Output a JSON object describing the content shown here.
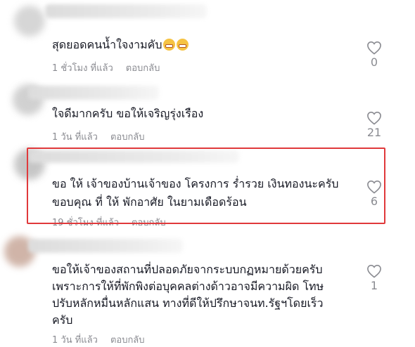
{
  "comments": [
    {
      "text_lines": [
        "สุดยอดคนน้ำใจงามคับ"
      ],
      "emoji": [
        "grinning-face-emoji",
        "grinning-face-emoji"
      ],
      "time": "1 ชั่วโมง ที่แล้ว",
      "reply": "ตอบกลับ",
      "likes": "0"
    },
    {
      "text_lines": [
        "ใจดีมากครับ ขอให้เจริญรุ่งเรือง"
      ],
      "time": "1 วัน ที่แล้ว",
      "reply": "ตอบกลับ",
      "likes": "21"
    },
    {
      "text_lines": [
        "ขอ ให้ เจ้าของบ้านเจ้าของ โครงการ ร่ำรวย เงินทองนะครับ",
        "ขอบคุณ ที่ ให้ พักอาศัย ในยามเดือดร้อน"
      ],
      "time": "19 ชั่วโมง ที่แล้ว",
      "reply": "ตอบกลับ",
      "likes": "6"
    },
    {
      "text_lines": [
        "ขอให้เจ้าของสถานที่ปลอดภัยจากระบบกฏหมายด้วยครับ",
        "เพราะการให้ที่พักพิงต่อบุคคลต่างด้าวอาจมีความผิด โทษ",
        "ปรับหลักหมื่นหลักแสน ทางที่ดีให้ปรึกษาจนท.รัฐฯโดยเร็ว",
        "ครับ"
      ],
      "time": "1 วัน ที่แล้ว",
      "reply": "ตอบกลับ",
      "likes": "1"
    }
  ],
  "highlight_color": "#e0393b",
  "icons": {
    "like": "heart-outline-icon"
  }
}
